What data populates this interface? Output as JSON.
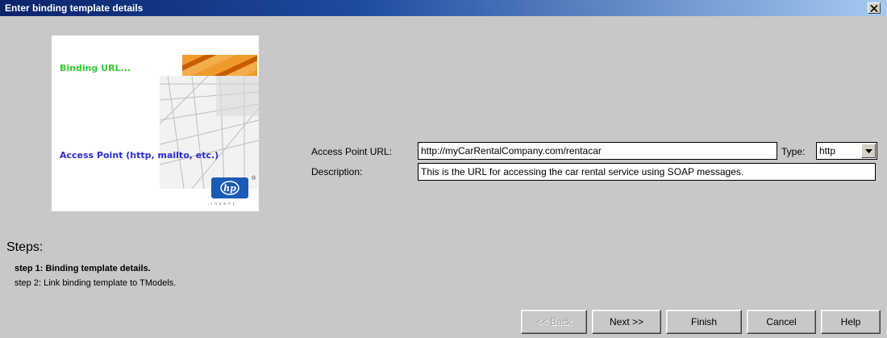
{
  "window": {
    "title": "Enter binding template details",
    "close_icon": "close-icon"
  },
  "banner_image": {
    "binding_text": "Binding URL...",
    "access_text": "Access Point (http, mailto, etc.)",
    "logo_text": "hp",
    "logo_tagline": "invent",
    "colors": {
      "binding": "#33cc33",
      "access": "#2b2bd6",
      "logo": "#1a5bb5",
      "accent": "#f09a2c"
    }
  },
  "form": {
    "access_point_label": "Access Point URL:",
    "access_point_value": "http://myCarRentalCompany.com/rentacar",
    "type_label": "Type:",
    "type_value": "http",
    "description_label": "Description:",
    "description_value": "This is the URL for accessing the car rental service using SOAP messages."
  },
  "steps": {
    "heading": "Steps:",
    "items": [
      {
        "label": "step 1: Binding template details.",
        "current": true
      },
      {
        "label": "step 2: Link binding template to TModels.",
        "current": false
      }
    ]
  },
  "buttons": {
    "back": "<< Back",
    "next": "Next >>",
    "finish": "Finish",
    "cancel": "Cancel",
    "help": "Help"
  }
}
